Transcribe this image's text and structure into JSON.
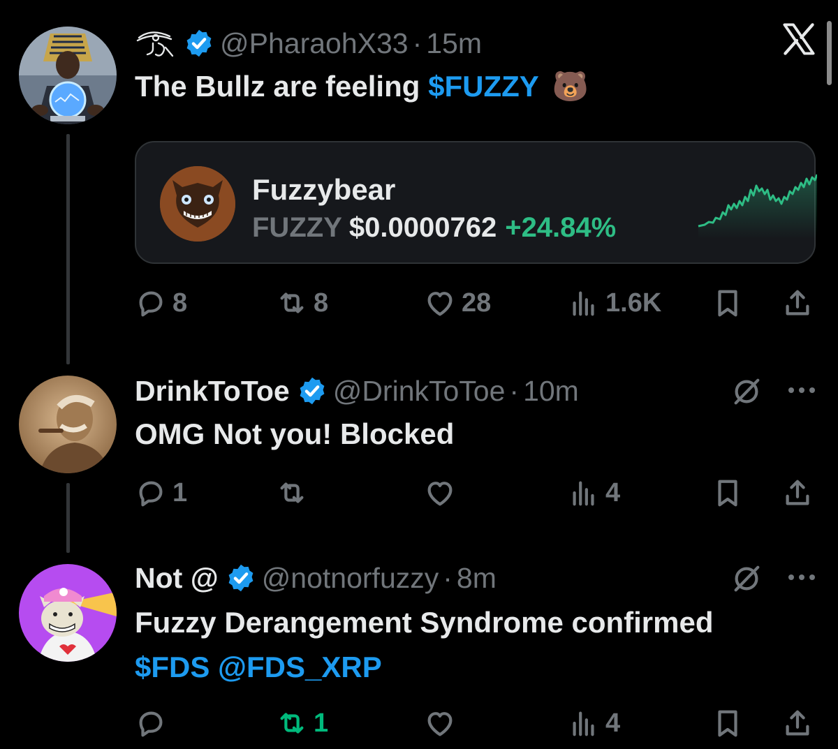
{
  "close_label": "X",
  "tweets": [
    {
      "name": "",
      "name_glyph": "eye-of-ra",
      "handle": "@PharaohX33",
      "separator": "·",
      "time": "15m",
      "text_plain": "The Bullz are feeling ",
      "text_cashtag": "$FUZZY",
      "text_emoji": "🐻",
      "actions": {
        "replies": "8",
        "reposts": "8",
        "likes": "28",
        "views": "1.6K"
      }
    },
    {
      "name": "DrinkToToe",
      "handle": "@DrinkToToe",
      "separator": "·",
      "time": "10m",
      "text": "OMG Not you!  Blocked",
      "actions": {
        "replies": "1",
        "reposts": "",
        "likes": "",
        "views": "4"
      }
    },
    {
      "name": "Not @",
      "handle": "@notnorfuzzy",
      "separator": "·",
      "time": "8m",
      "text_line1": "Fuzzy Derangement Syndrome confirmed",
      "text_cashtag": "$FDS",
      "text_mention": "@FDS_XRP",
      "actions": {
        "replies": "",
        "reposts": "1",
        "likes": "",
        "views": "4"
      }
    }
  ],
  "token_card": {
    "name": "Fuzzybear",
    "symbol": "FUZZY",
    "price": "$0.0000762",
    "change": "+24.84%"
  },
  "colors": {
    "background": "#000000",
    "link": "#1d9bf0",
    "verified": "#1d9bf0",
    "positive": "#2ebd85",
    "repost_active": "#00ba7c",
    "muted": "#71767b"
  },
  "icons": [
    "reply-icon",
    "repost-icon",
    "like-icon",
    "views-icon",
    "bookmark-icon",
    "share-icon",
    "grok-icon",
    "more-icon",
    "verified-badge-icon",
    "x-logo-icon"
  ]
}
